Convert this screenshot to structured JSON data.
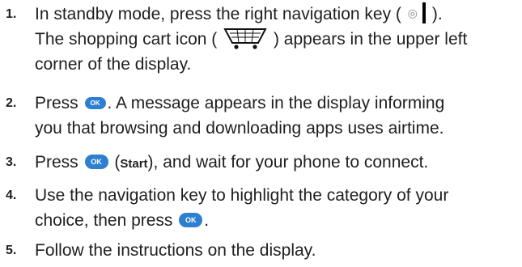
{
  "steps": [
    {
      "number": "1.",
      "line1_a": "In standby mode, press the right navigation key (",
      "line1_b": ").",
      "line2_a": "The shopping cart icon (",
      "line2_b": ") appears in the upper left",
      "line3": "corner of the display."
    },
    {
      "number": "2.",
      "line1_a": "Press",
      "line1_b": ". A message appears in the display informing",
      "line2": "you that browsing and downloading apps uses airtime."
    },
    {
      "number": "3.",
      "line1_a": "Press",
      "line1_b": " (",
      "bold": "Start",
      "line1_c": "), and wait for your phone to connect."
    },
    {
      "number": "4.",
      "line1": "Use the navigation key to highlight the category of your",
      "line2_a": "choice, then press",
      "line2_b": "."
    },
    {
      "number": "5.",
      "line1": "Follow the instructions on the display."
    }
  ],
  "icons": {
    "ok_label": "OK",
    "ok_color": "#2f7fd1",
    "nav_key_glyph": "◎",
    "cart_icon": "shopping-cart-icon"
  }
}
